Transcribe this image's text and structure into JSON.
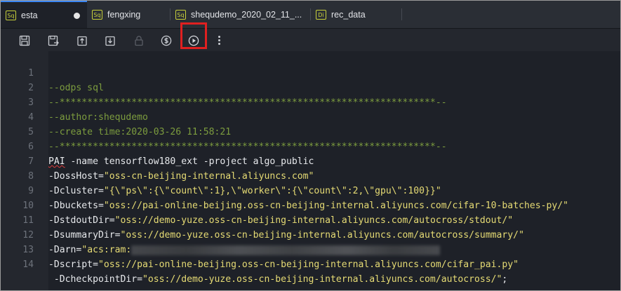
{
  "tabs": [
    {
      "type": "Sq",
      "label": "esta",
      "active": true,
      "modified": true
    },
    {
      "type": "Sq",
      "label": "fengxing"
    },
    {
      "type": "Sq",
      "label": "shequdemo_2020_02_11_..."
    },
    {
      "type": "Di",
      "label": "rec_data"
    }
  ],
  "toolbar": {
    "icons": [
      "save-icon",
      "save-as-icon",
      "upload-icon",
      "download-icon",
      "lock-icon",
      "cost-estimate-icon",
      "run-icon",
      "more-icon"
    ]
  },
  "editor": {
    "line_numbers": [
      "1",
      "2",
      "3",
      "4",
      "5",
      "6",
      "7",
      "8",
      "9",
      "10",
      "11",
      "12",
      "13",
      "14"
    ],
    "lines": {
      "l1": "--odps sql",
      "l2": "--********************************************************************--",
      "l3": "--author:shequdemo",
      "l4": "--create time:2020-03-26 11:58:21",
      "l5": "--********************************************************************--",
      "l6_kw": "PAI",
      "l6_rest": " -name tensorflow180_ext -project algo_public",
      "l7_k": "-DossHost=",
      "l7_v": "\"oss-cn-beijing-internal.aliyuncs.com\"",
      "l8_k": "-Dcluster=",
      "l8_v": "\"{\\\"ps\\\":{\\\"count\\\":1},\\\"worker\\\":{\\\"count\\\":2,\\\"gpu\\\":100}}\"",
      "l9_k": "-Dbuckets=",
      "l9_v": "\"oss://pai-online-beijing.oss-cn-beijing-internal.aliyuncs.com/cifar-10-batches-py/\"",
      "l10_k": "-DstdoutDir=",
      "l10_v": "\"oss://demo-yuze.oss-cn-beijing-internal.aliyuncs.com/autocross/stdout/\"",
      "l11_k": "-DsummaryDir=",
      "l11_v": "\"oss://demo-yuze.oss-cn-beijing-internal.aliyuncs.com/autocross/summary/\"",
      "l12_k": "-Darn=",
      "l12_v": "\"acs:ram:",
      "l13_k": "-Dscript=",
      "l13_v": "\"oss://pai-online-beijing.oss-cn-beijing-internal.aliyuncs.com/cifar_pai.py\"",
      "l14_k": " -DcheckpointDir=",
      "l14_v": "\"oss://demo-yuze.oss-cn-beijing-internal.aliyuncs.com/autocross/\"",
      "l14_end": ";"
    }
  },
  "colors": {
    "accent": "#3b87f5",
    "highlight_box": "#e02020",
    "comment": "#7c9c3e",
    "string": "#e6db74",
    "file_badge": "#c9d13a"
  }
}
